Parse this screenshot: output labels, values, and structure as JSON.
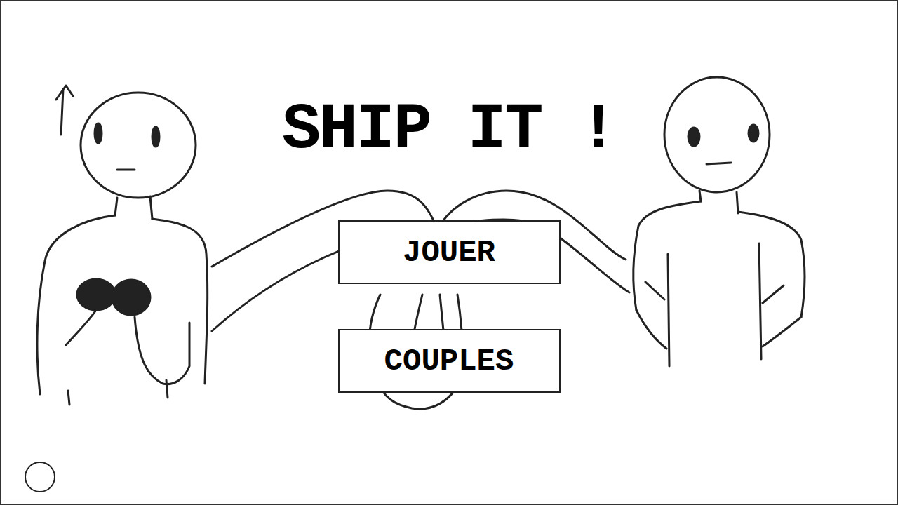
{
  "title": "SHIP IT !",
  "menu": [
    {
      "label": "JOUER"
    },
    {
      "label": "COUPLES"
    }
  ]
}
